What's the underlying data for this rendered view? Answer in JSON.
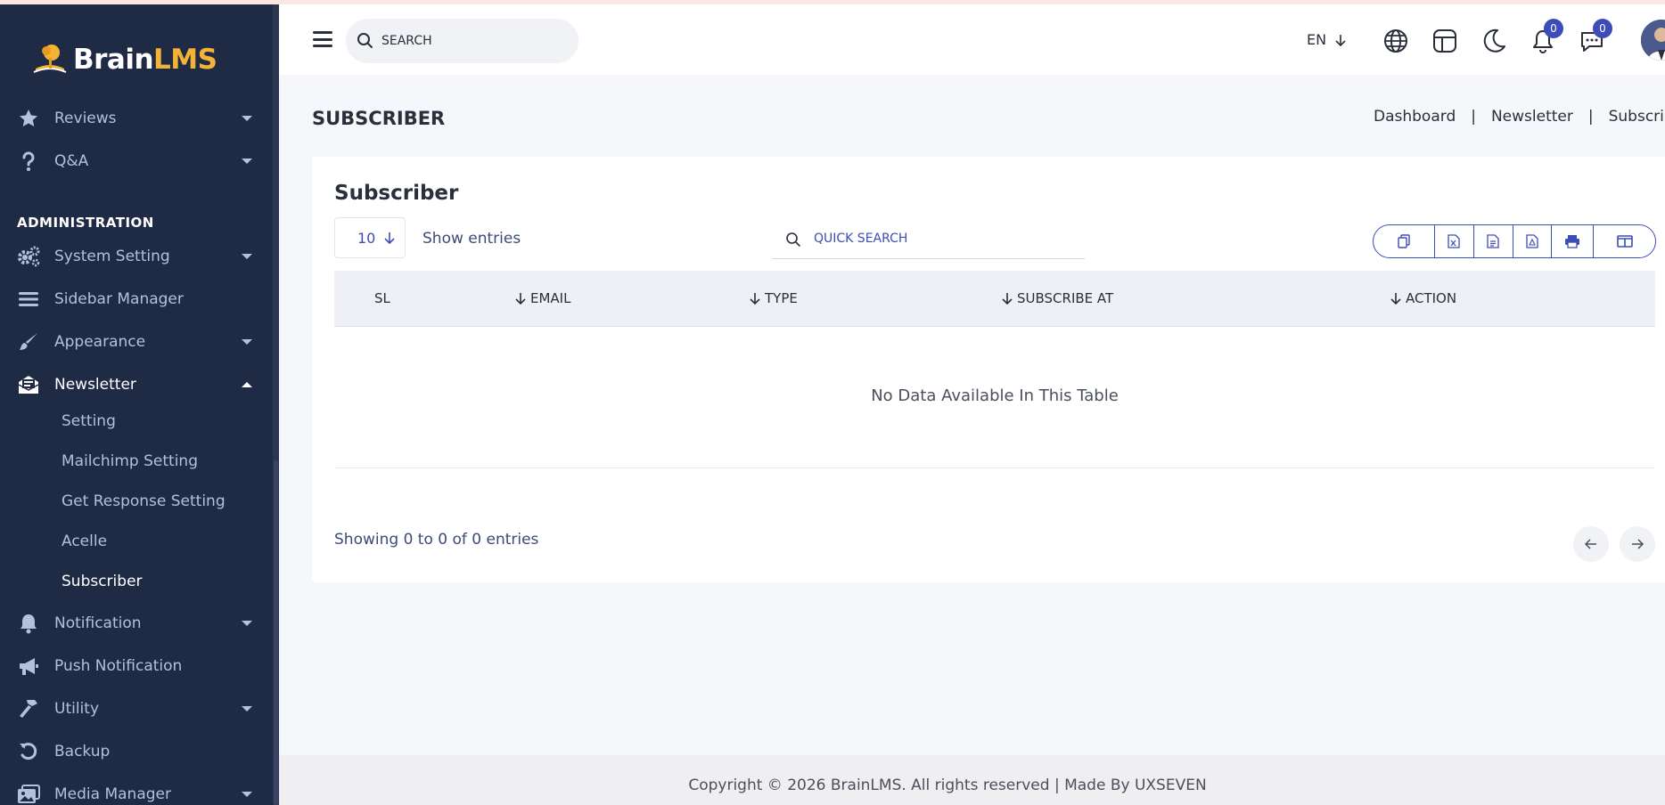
{
  "app": {
    "logo_main": "Brain",
    "logo_accent": "LMS"
  },
  "header": {
    "search_placeholder": "SEARCH",
    "language": "EN",
    "notification_count": "0",
    "message_count": "0"
  },
  "sidebar": {
    "items_top": [
      {
        "label": "Reviews",
        "icon": "star-icon"
      },
      {
        "label": "Q&A",
        "icon": "question-icon"
      }
    ],
    "section_title": "ADMINISTRATION",
    "items": [
      {
        "label": "System Setting",
        "icon": "gears-icon"
      },
      {
        "label": "Sidebar Manager",
        "icon": "bars-icon"
      },
      {
        "label": "Appearance",
        "icon": "brush-icon"
      },
      {
        "label": "Newsletter",
        "icon": "envelope-open-icon"
      }
    ],
    "newsletter_sub": [
      "Setting",
      "Mailchimp Setting",
      "Get Response Setting",
      "Acelle",
      "Subscriber"
    ],
    "items_bottom": [
      {
        "label": "Notification",
        "icon": "bell-icon"
      },
      {
        "label": "Push Notification",
        "icon": "megaphone-icon"
      },
      {
        "label": "Utility",
        "icon": "hammer-icon"
      },
      {
        "label": "Backup",
        "icon": "undo-icon"
      },
      {
        "label": "Media Manager",
        "icon": "images-icon"
      }
    ]
  },
  "page": {
    "title": "SUBSCRIBER",
    "breadcrumb": [
      "Dashboard",
      "Newsletter",
      "Subscriber"
    ]
  },
  "card": {
    "title": "Subscriber",
    "entries_value": "10",
    "show_entries_label": "Show entries",
    "quick_search_placeholder": "QUICK SEARCH",
    "export_buttons": [
      "copy-icon",
      "excel-icon",
      "csv-icon",
      "pdf-icon",
      "print-icon",
      "columns-icon"
    ],
    "columns": [
      "SL",
      "EMAIL",
      "TYPE",
      "SUBSCRIBE AT",
      "ACTION"
    ],
    "empty_message": "No Data Available In This Table",
    "showing_text": "Showing 0 to 0 of 0 entries"
  },
  "footer": {
    "text": "Copyright © 2026 BrainLMS. All rights reserved | Made By UXSEVEN"
  },
  "colors": {
    "sidebar_bg": "#1f2a44",
    "accent": "#3d4db7",
    "logo_accent": "#f5b335"
  }
}
